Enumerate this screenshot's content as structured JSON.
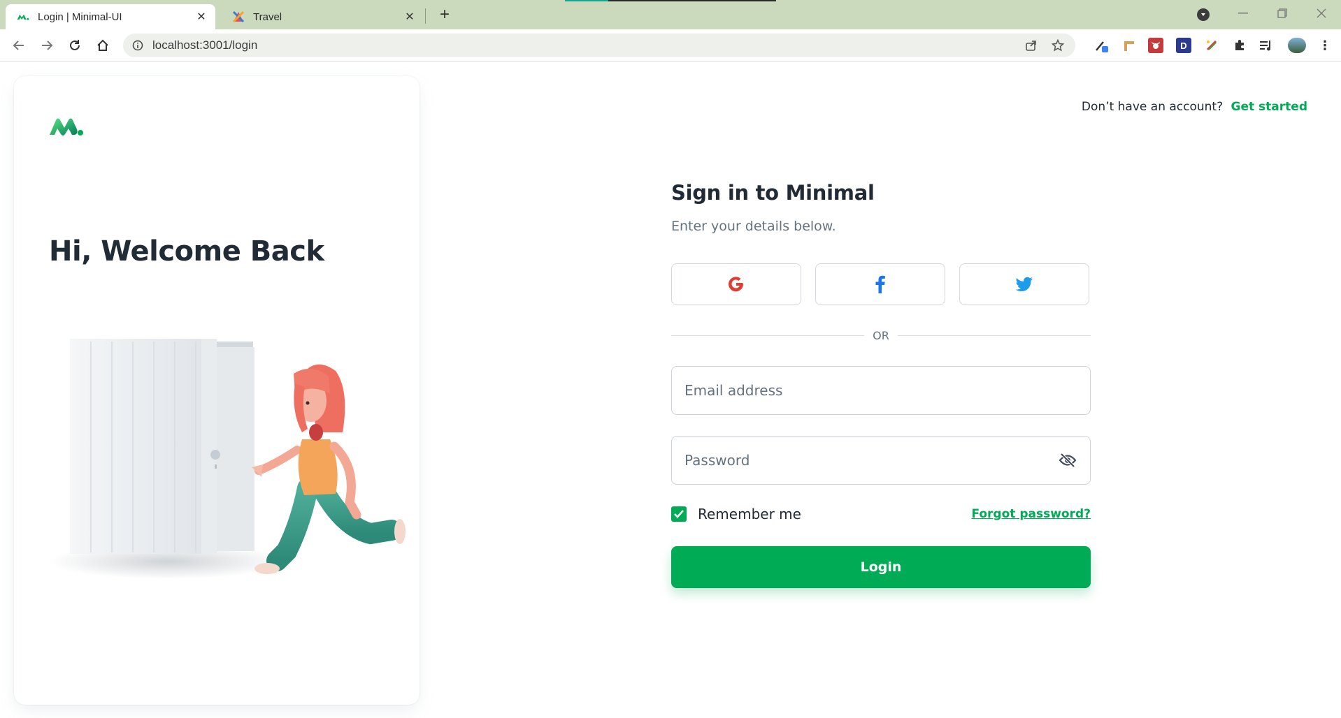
{
  "browser": {
    "tabs": [
      {
        "title": "Login | Minimal-UI",
        "active": true,
        "favicon": "minimal-logo-icon"
      },
      {
        "title": "Travel",
        "active": false,
        "favicon": "travel-favicon-icon"
      }
    ],
    "url": "localhost:3001/login",
    "extensions": [
      "eyedropper-extension-icon",
      "ruler-extension-icon",
      "bug-extension-icon",
      "d-extension-icon",
      "color-extension-icon",
      "puzzle-icon",
      "media-list-icon",
      "profile-avatar"
    ]
  },
  "header": {
    "prompt_text": "Don’t have an account?",
    "get_started_label": "Get started"
  },
  "left_panel": {
    "welcome_title": "Hi, Welcome Back"
  },
  "form": {
    "title": "Sign in to Minimal",
    "subtitle": "Enter your details below.",
    "social": [
      "google-icon",
      "facebook-icon",
      "twitter-icon"
    ],
    "divider_label": "OR",
    "email_placeholder": "Email address",
    "password_placeholder": "Password",
    "remember_label": "Remember me",
    "remember_checked": true,
    "forgot_label": "Forgot password?",
    "login_label": "Login"
  },
  "colors": {
    "accent": "#00ab55",
    "text_primary": "#212b36",
    "text_secondary": "#637381",
    "tabbar": "#cbd9bd"
  }
}
